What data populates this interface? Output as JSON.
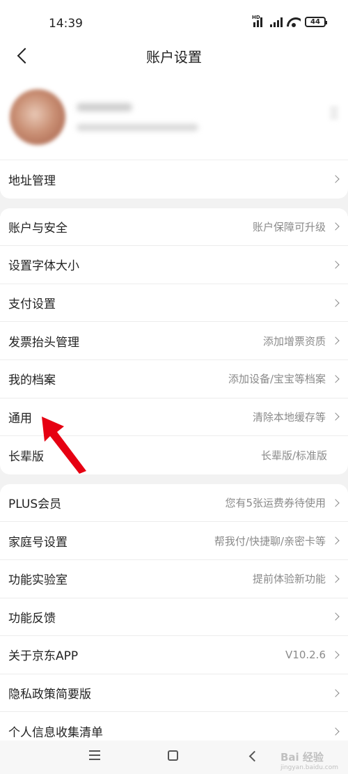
{
  "status_bar": {
    "time": "14:39",
    "signal_label": "HD",
    "battery": "44"
  },
  "header": {
    "title": "账户设置"
  },
  "groups": {
    "address": {
      "label": "地址管理"
    },
    "account": [
      {
        "label": "账户与安全",
        "value": "账户保障可升级"
      },
      {
        "label": "设置字体大小",
        "value": ""
      },
      {
        "label": "支付设置",
        "value": ""
      },
      {
        "label": "发票抬头管理",
        "value": "添加增票资质"
      },
      {
        "label": "我的档案",
        "value": "添加设备/宝宝等档案"
      },
      {
        "label": "通用",
        "value": "清除本地缓存等"
      },
      {
        "label": "长辈版",
        "value": "长辈版/标准版"
      }
    ],
    "more": [
      {
        "label": "PLUS会员",
        "value": "您有5张运费券待使用"
      },
      {
        "label": "家庭号设置",
        "value": "帮我付/快捷聊/亲密卡等"
      },
      {
        "label": "功能实验室",
        "value": "提前体验新功能"
      },
      {
        "label": "功能反馈",
        "value": ""
      },
      {
        "label": "关于京东APP",
        "value": "V10.2.6"
      },
      {
        "label": "隐私政策简要版",
        "value": ""
      },
      {
        "label": "个人信息收集清单",
        "value": ""
      }
    ]
  },
  "watermark": {
    "text": "Bai 经验",
    "sub": "jingyan.baidu.com"
  },
  "colors": {
    "arrow": "#e60012",
    "background": "#f2f2f2"
  }
}
